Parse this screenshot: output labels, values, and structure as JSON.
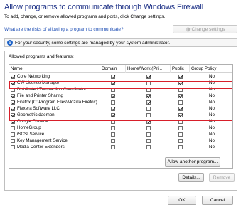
{
  "header": {
    "title": "Allow programs to communicate through Windows Firewall",
    "subtitle": "To add, change, or remove allowed programs and ports, click Change settings.",
    "risk_link": "What are the risks of allowing a program to communicate?",
    "change_settings": "Change settings"
  },
  "info_bar": {
    "text": "For your security, some settings are managed by your system administrator."
  },
  "group": {
    "label": "Allowed programs and features:",
    "columns": [
      "Name",
      "Domain",
      "Home/Work (Pri...",
      "Public",
      "Group Policy"
    ],
    "rows": [
      {
        "name": "Core Networking",
        "enabled": true,
        "domain": true,
        "home": true,
        "public": true,
        "policy": "No"
      },
      {
        "name": "CW License Manager",
        "enabled": true,
        "domain": true,
        "home": false,
        "public": true,
        "policy": "No"
      },
      {
        "name": "Distributed Transaction Coordinator",
        "enabled": false,
        "domain": false,
        "home": false,
        "public": false,
        "policy": "No"
      },
      {
        "name": "File and Printer Sharing",
        "enabled": true,
        "domain": true,
        "home": true,
        "public": true,
        "policy": "No"
      },
      {
        "name": "Firefox (C:\\Program Files\\Mozilla Firefox)",
        "enabled": true,
        "domain": false,
        "home": true,
        "public": false,
        "policy": "No"
      },
      {
        "name": "Flexera Software LLC",
        "enabled": true,
        "domain": true,
        "home": false,
        "public": true,
        "policy": "No"
      },
      {
        "name": "Geometric daemon",
        "enabled": true,
        "domain": true,
        "home": false,
        "public": true,
        "policy": "No"
      },
      {
        "name": "Google Chrome",
        "enabled": true,
        "domain": false,
        "home": true,
        "public": false,
        "policy": "No"
      },
      {
        "name": "HomeGroup",
        "enabled": false,
        "domain": false,
        "home": false,
        "public": false,
        "policy": "No"
      },
      {
        "name": "iSCSI Service",
        "enabled": false,
        "domain": false,
        "home": false,
        "public": false,
        "policy": "No"
      },
      {
        "name": "Key Management Service",
        "enabled": false,
        "domain": false,
        "home": false,
        "public": false,
        "policy": "No"
      },
      {
        "name": "Media Center Extenders",
        "enabled": false,
        "domain": false,
        "home": false,
        "public": false,
        "policy": "No"
      }
    ],
    "details": "Details...",
    "remove": "Remove"
  },
  "allow_another": "Allow another program...",
  "footer": {
    "ok": "OK",
    "cancel": "Cancel"
  },
  "colors": {
    "title": "#1e3287",
    "link": "#1f4fb5",
    "highlight": "#d81f2a",
    "info_icon": "#1c62c8"
  }
}
